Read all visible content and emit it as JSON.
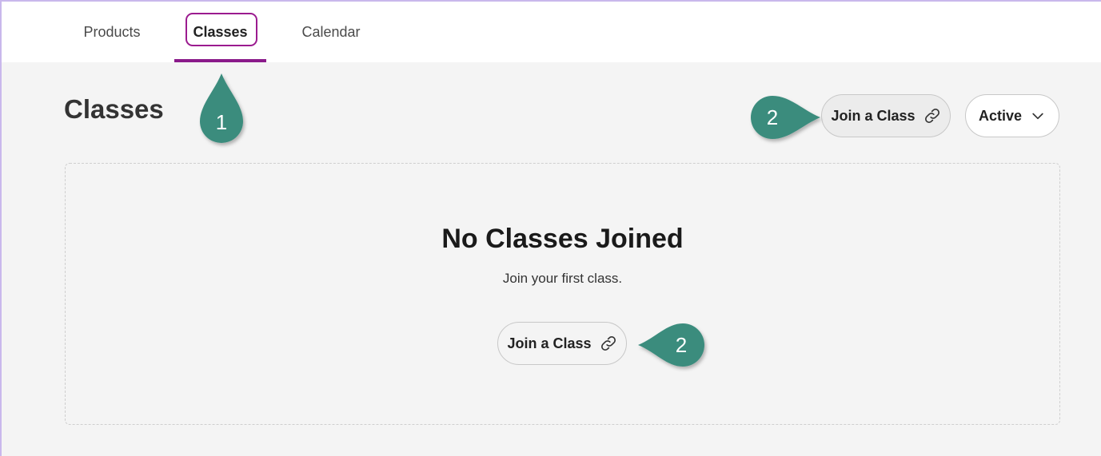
{
  "nav": {
    "tabs": [
      {
        "label": "Products"
      },
      {
        "label": "Classes"
      },
      {
        "label": "Calendar"
      }
    ]
  },
  "page": {
    "title": "Classes",
    "join_label": "Join a Class",
    "status_selected": "Active"
  },
  "empty_state": {
    "title": "No Classes Joined",
    "subtitle": "Join your first class.",
    "join_label": "Join a Class"
  },
  "callouts": {
    "one": "1",
    "two": "2"
  },
  "colors": {
    "accent": "#8a1a8a",
    "callout": "#3a8c7d",
    "frame": "#c9b8ec"
  }
}
